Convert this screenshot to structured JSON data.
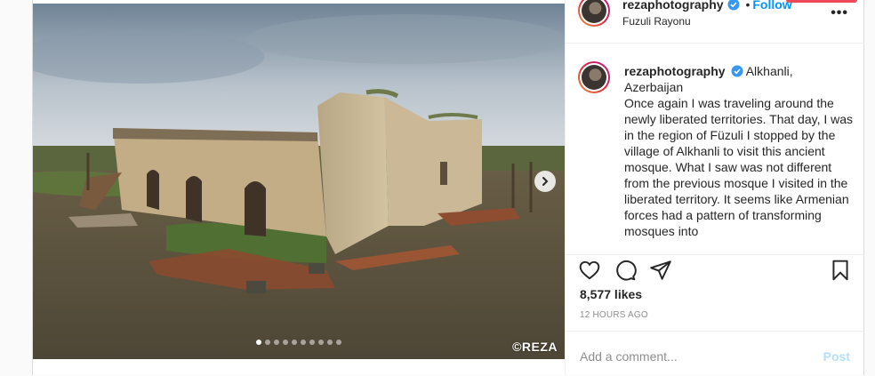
{
  "post": {
    "photo": {
      "credit": "©REZA",
      "dots_total": 10,
      "dots_active": 0,
      "next_icon": "chevron-right-icon"
    },
    "header": {
      "username": "rezaphotography",
      "separator": "•",
      "follow_label": "Follow",
      "location": "Fuzuli Rayonu",
      "more_icon": "more-options-icon",
      "more_label": "•••"
    },
    "caption": {
      "username": "rezaphotography",
      "location_line": "Alkhanli, Azerbaijan",
      "text": "Once again I was traveling around the newly liberated territories. That day, I was in the region of Füzuli I stopped by the village of Alkhanli to visit this ancient mosque. What I saw was not different from the previous mosque I visited in the liberated territory. It seems like Armenian forces had a pattern of transforming mosques into"
    },
    "actions": {
      "like_icon": "heart-icon",
      "comment_icon": "comment-icon",
      "share_icon": "share-icon",
      "save_icon": "bookmark-icon",
      "likes": "8,577 likes",
      "time": "12 HOURS AGO"
    },
    "comment": {
      "placeholder": "Add a comment...",
      "post_label": "Post"
    },
    "colors": {
      "accent": "#0095f6",
      "verified": "#3897f0",
      "post_disabled": "#b2dffc"
    }
  }
}
